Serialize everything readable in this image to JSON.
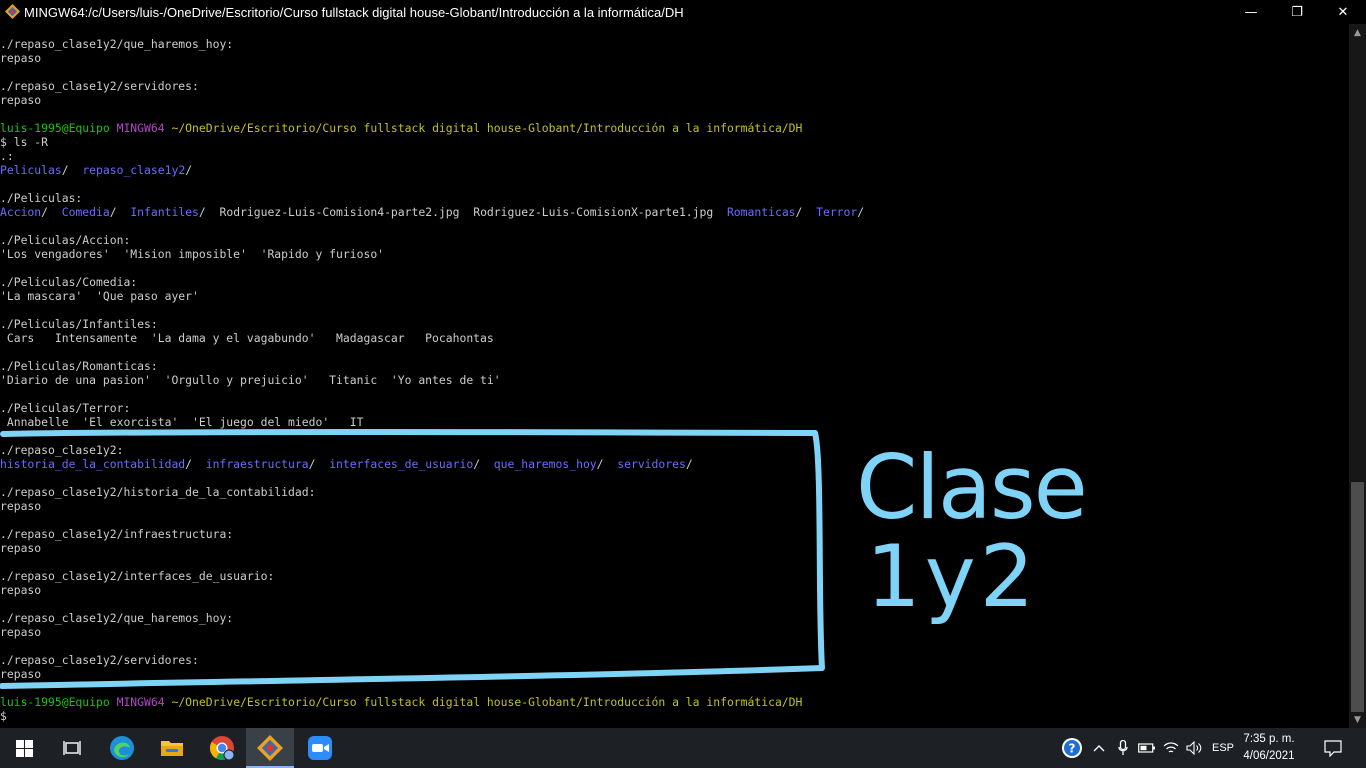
{
  "window": {
    "title": "MINGW64:/c/Users/luis-/OneDrive/Escritorio/Curso fullstack digital house-Globant/Introducción a la informática/DH",
    "minimize": "—",
    "maximize": "❐",
    "close": "✕"
  },
  "terminal": {
    "lines": [
      [
        {
          "t": "./repaso_clase1y2/que_haremos_hoy:",
          "c": "white"
        }
      ],
      [
        {
          "t": "repaso",
          "c": "white"
        }
      ],
      [],
      [
        {
          "t": "./repaso_clase1y2/servidores:",
          "c": "white"
        }
      ],
      [
        {
          "t": "repaso",
          "c": "white"
        }
      ],
      [],
      [
        {
          "t": "luis-1995@Equipo ",
          "c": "green"
        },
        {
          "t": "MINGW64 ",
          "c": "magenta"
        },
        {
          "t": "~/OneDrive/Escritorio/Curso fullstack digital house-Globant/Introducción a la informática/DH",
          "c": "yellow"
        }
      ],
      [
        {
          "t": "$ ls -R",
          "c": "white"
        }
      ],
      [
        {
          "t": ".:",
          "c": "white"
        }
      ],
      [
        {
          "t": "Peliculas",
          "c": "blue"
        },
        {
          "t": "/  ",
          "c": "white"
        },
        {
          "t": "repaso_clase1y2",
          "c": "blue"
        },
        {
          "t": "/",
          "c": "white"
        }
      ],
      [],
      [
        {
          "t": "./Peliculas:",
          "c": "white"
        }
      ],
      [
        {
          "t": "Accion",
          "c": "blue"
        },
        {
          "t": "/  ",
          "c": "white"
        },
        {
          "t": "Comedia",
          "c": "blue"
        },
        {
          "t": "/  ",
          "c": "white"
        },
        {
          "t": "Infantiles",
          "c": "blue"
        },
        {
          "t": "/  Rodriguez-Luis-Comision4-parte2.jpg  Rodriguez-Luis-ComisionX-parte1.jpg  ",
          "c": "white"
        },
        {
          "t": "Romanticas",
          "c": "blue"
        },
        {
          "t": "/  ",
          "c": "white"
        },
        {
          "t": "Terror",
          "c": "blue"
        },
        {
          "t": "/",
          "c": "white"
        }
      ],
      [],
      [
        {
          "t": "./Peliculas/Accion:",
          "c": "white"
        }
      ],
      [
        {
          "t": "'Los vengadores'  'Mision imposible'  'Rapido y furioso'",
          "c": "white"
        }
      ],
      [],
      [
        {
          "t": "./Peliculas/Comedia:",
          "c": "white"
        }
      ],
      [
        {
          "t": "'La mascara'  'Que paso ayer'",
          "c": "white"
        }
      ],
      [],
      [
        {
          "t": "./Peliculas/Infantiles:",
          "c": "white"
        }
      ],
      [
        {
          "t": " Cars   Intensamente  'La dama y el vagabundo'   Madagascar   Pocahontas",
          "c": "white"
        }
      ],
      [],
      [
        {
          "t": "./Peliculas/Romanticas:",
          "c": "white"
        }
      ],
      [
        {
          "t": "'Diario de una pasion'  'Orgullo y prejuicio'   Titanic  'Yo antes de ti'",
          "c": "white"
        }
      ],
      [],
      [
        {
          "t": "./Peliculas/Terror:",
          "c": "white"
        }
      ],
      [
        {
          "t": " Annabelle  'El exorcista'  'El juego del miedo'   IT",
          "c": "white"
        }
      ],
      [],
      [
        {
          "t": "./repaso_clase1y2:",
          "c": "white"
        }
      ],
      [
        {
          "t": "historia_de_la_contabilidad",
          "c": "blue"
        },
        {
          "t": "/  ",
          "c": "white"
        },
        {
          "t": "infraestructura",
          "c": "blue"
        },
        {
          "t": "/  ",
          "c": "white"
        },
        {
          "t": "interfaces_de_usuario",
          "c": "blue"
        },
        {
          "t": "/  ",
          "c": "white"
        },
        {
          "t": "que_haremos_hoy",
          "c": "blue"
        },
        {
          "t": "/  ",
          "c": "white"
        },
        {
          "t": "servidores",
          "c": "blue"
        },
        {
          "t": "/",
          "c": "white"
        }
      ],
      [],
      [
        {
          "t": "./repaso_clase1y2/historia_de_la_contabilidad:",
          "c": "white"
        }
      ],
      [
        {
          "t": "repaso",
          "c": "white"
        }
      ],
      [],
      [
        {
          "t": "./repaso_clase1y2/infraestructura:",
          "c": "white"
        }
      ],
      [
        {
          "t": "repaso",
          "c": "white"
        }
      ],
      [],
      [
        {
          "t": "./repaso_clase1y2/interfaces_de_usuario:",
          "c": "white"
        }
      ],
      [
        {
          "t": "repaso",
          "c": "white"
        }
      ],
      [],
      [
        {
          "t": "./repaso_clase1y2/que_haremos_hoy:",
          "c": "white"
        }
      ],
      [
        {
          "t": "repaso",
          "c": "white"
        }
      ],
      [],
      [
        {
          "t": "./repaso_clase1y2/servidores:",
          "c": "white"
        }
      ],
      [
        {
          "t": "repaso",
          "c": "white"
        }
      ],
      [],
      [
        {
          "t": "luis-1995@Equipo ",
          "c": "green"
        },
        {
          "t": "MINGW64 ",
          "c": "magenta"
        },
        {
          "t": "~/OneDrive/Escritorio/Curso fullstack digital house-Globant/Introducción a la informática/DH",
          "c": "yellow"
        }
      ],
      [
        {
          "t": "$",
          "c": "white"
        }
      ]
    ]
  },
  "annotation": {
    "text_line1": "Clase",
    "text_line2": "1y2",
    "color": "#7fd3f7"
  },
  "taskbar": {
    "language": "ESP",
    "time": "7:35 p. m.",
    "date": "4/06/2021"
  },
  "colors": {
    "green": "#16c60c",
    "magenta": "#b148c6",
    "yellow": "#c1c120",
    "blue": "#6b6bff",
    "text": "#cccccc"
  }
}
